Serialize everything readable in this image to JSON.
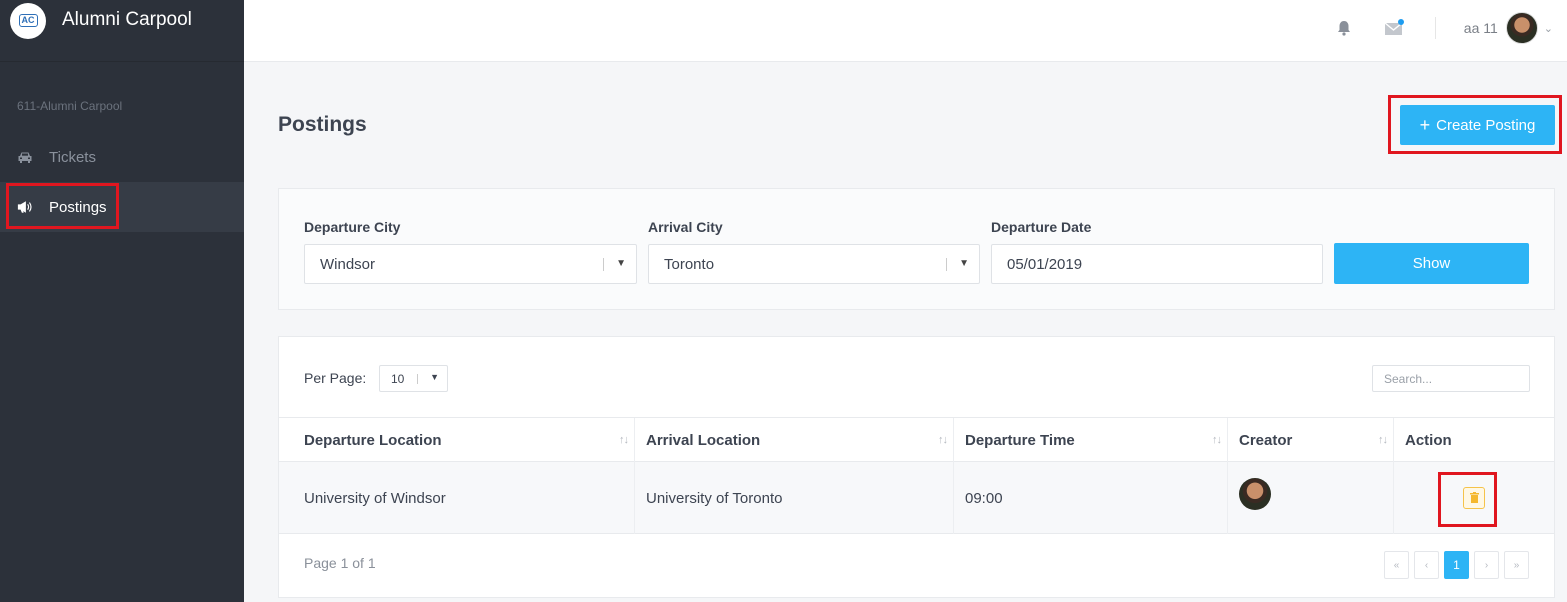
{
  "app": {
    "name": "Alumni Carpool",
    "logo_text": "AC"
  },
  "sidebar": {
    "section": "611-Alumni Carpool",
    "items": [
      {
        "label": "Tickets",
        "icon": "car-icon",
        "active": false
      },
      {
        "label": "Postings",
        "icon": "megaphone-icon",
        "active": true
      }
    ]
  },
  "topbar": {
    "user_name": "aa 11",
    "notification_dot_color": "#1d9cf0"
  },
  "page": {
    "title": "Postings",
    "create_button": "Create Posting"
  },
  "filters": {
    "departure_city": {
      "label": "Departure City",
      "value": "Windsor"
    },
    "arrival_city": {
      "label": "Arrival City",
      "value": "Toronto"
    },
    "departure_date": {
      "label": "Departure Date",
      "value": "05/01/2019"
    },
    "show_button": "Show"
  },
  "table": {
    "per_page_label": "Per Page:",
    "per_page_value": "10",
    "search_placeholder": "Search...",
    "columns": [
      "Departure Location",
      "Arrival Location",
      "Departure Time",
      "Creator",
      "Action"
    ],
    "rows": [
      {
        "departure": "University of Windsor",
        "arrival": "University of Toronto",
        "time": "09:00"
      }
    ],
    "page_info": "Page 1 of 1",
    "pager": {
      "first": "«",
      "prev": "‹",
      "current": "1",
      "next": "›",
      "last": "»"
    }
  },
  "colors": {
    "accent": "#2db4f5",
    "sidebar_bg": "#2c313a",
    "highlight": "#e0161f",
    "delete_icon": "#f5b82e"
  }
}
